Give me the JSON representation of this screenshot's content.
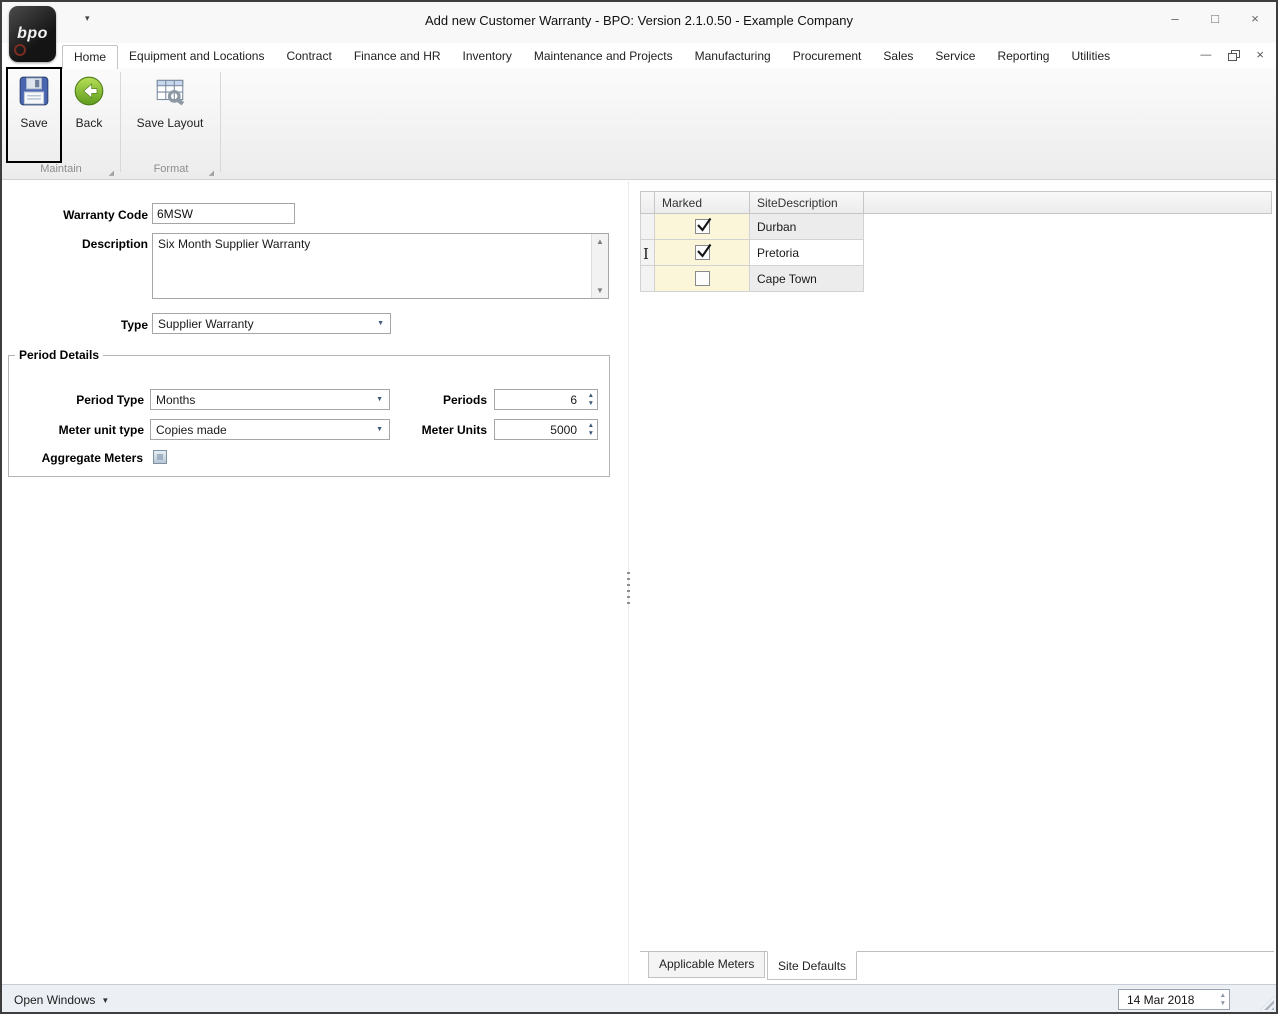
{
  "colors": {
    "back_icon_green": "#76b82a",
    "save_icon_blue": "#4a66b0",
    "marked_cell_cream": "#fbf5da",
    "highlight_border": "#000000"
  },
  "icons": {
    "caret_down_small": "▾",
    "dropdown_arrow": "▼",
    "spin_up": "▲",
    "spin_down": "▼",
    "minimize": "–",
    "maximize": "□",
    "close": "×",
    "mdi_minimize": "—",
    "mdi_close": "×",
    "group_launcher": "◢",
    "scroll_up": "▲",
    "scroll_down": "▼",
    "text_cursor": "I"
  },
  "window": {
    "logo_text": "bpo",
    "title": "Add new Customer Warranty - BPO: Version 2.1.0.50 - Example Company"
  },
  "ribbon": {
    "tabs": [
      {
        "label": "Home"
      },
      {
        "label": "Equipment and Locations"
      },
      {
        "label": "Contract"
      },
      {
        "label": "Finance and HR"
      },
      {
        "label": "Inventory"
      },
      {
        "label": "Maintenance and Projects"
      },
      {
        "label": "Manufacturing"
      },
      {
        "label": "Procurement"
      },
      {
        "label": "Sales"
      },
      {
        "label": "Service"
      },
      {
        "label": "Reporting"
      },
      {
        "label": "Utilities"
      }
    ],
    "active_tab": "Home",
    "buttons": {
      "save": "Save",
      "back": "Back",
      "save_layout": "Save Layout"
    },
    "groups": {
      "maintain": "Maintain",
      "format": "Format"
    }
  },
  "form": {
    "warranty_code_label": "Warranty Code",
    "warranty_code_value": "6MSW",
    "description_label": "Description",
    "description_value": "Six Month Supplier Warranty",
    "type_label": "Type",
    "type_value": "Supplier Warranty",
    "period_details": {
      "title": "Period Details",
      "period_type_label": "Period Type",
      "period_type_value": "Months",
      "periods_label": "Periods",
      "periods_value": "6",
      "meter_unit_type_label": "Meter unit type",
      "meter_unit_type_value": "Copies made",
      "meter_units_label": "Meter Units",
      "meter_units_value": "5000",
      "aggregate_meters_label": "Aggregate Meters"
    }
  },
  "site_grid": {
    "columns": {
      "marked": "Marked",
      "site_description": "SiteDescription"
    },
    "rows": [
      {
        "site": "Durban",
        "marked": true
      },
      {
        "site": "Pretoria",
        "marked": true
      },
      {
        "site": "Cape Town",
        "marked": false
      }
    ],
    "tabs": {
      "applicable_meters": "Applicable Meters",
      "site_defaults": "Site Defaults"
    }
  },
  "status_bar": {
    "open_windows": "Open Windows",
    "date": "14 Mar 2018"
  }
}
